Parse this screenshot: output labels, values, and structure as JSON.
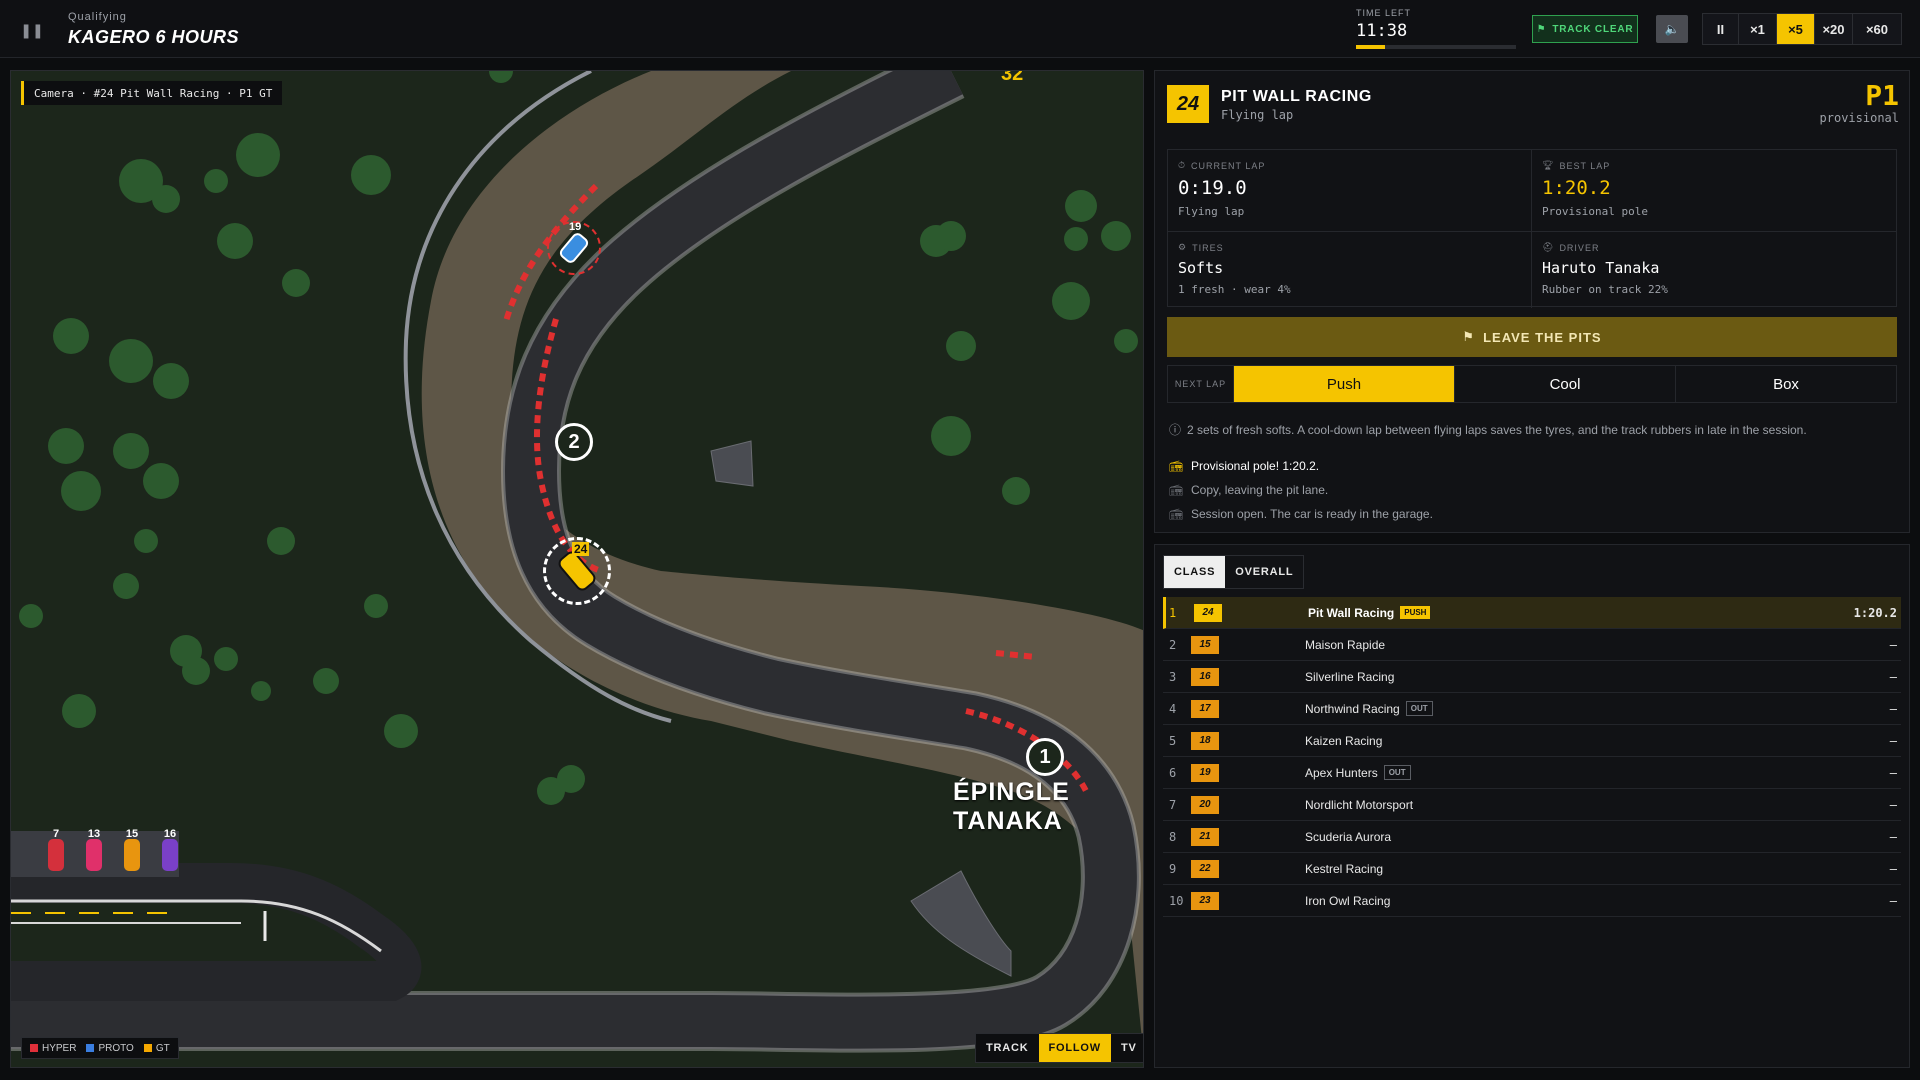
{
  "header": {
    "session_type": "Qualifying",
    "event_title": "KAGERO 6 HOURS",
    "time_left_label": "TIME LEFT",
    "time_left": "11:38",
    "time_left_fraction": 0.18,
    "flag_status": "TRACK CLEAR",
    "speed_options": [
      "II",
      "×1",
      "×5",
      "×20",
      "×60"
    ],
    "active_speed": "×5"
  },
  "map": {
    "camera_label": "Camera · #24 Pit Wall Racing · P1 GT",
    "corner_name": "ÉPINGLE TANAKA",
    "turn_numbers": [
      "1",
      "2"
    ],
    "partial_label": "32",
    "cars": [
      {
        "number": "24",
        "color": "#f5c400"
      },
      {
        "number": "19",
        "color": "#3a8ee0"
      }
    ],
    "garage_cars": [
      {
        "number": "7",
        "color": "#d4303c"
      },
      {
        "number": "13",
        "color": "#e0306a"
      },
      {
        "number": "15",
        "color": "#e8950f"
      },
      {
        "number": "16",
        "color": "#7a40c8"
      }
    ],
    "legend": [
      {
        "label": "HYPER",
        "color": "#e0303a"
      },
      {
        "label": "PROTO",
        "color": "#3a7ee0"
      },
      {
        "label": "GT",
        "color": "#f5a800"
      }
    ],
    "view_modes": [
      "TRACK",
      "FOLLOW",
      "TV"
    ],
    "active_view": "FOLLOW"
  },
  "car_panel": {
    "car_number": "24",
    "team": "PIT WALL RACING",
    "status": "Flying lap",
    "position": "P1",
    "position_note": "provisional",
    "current_lap_label": "CURRENT LAP",
    "current_lap": "0:19.0",
    "current_lap_note": "Flying lap",
    "best_lap_label": "BEST LAP",
    "best_lap": "1:20.2",
    "best_lap_note": "Provisional pole",
    "tires_label": "TIRES",
    "tires": "Softs",
    "tires_note": "1 fresh · wear 4%",
    "driver_label": "DRIVER",
    "driver": "Haruto Tanaka",
    "driver_note": "Rubber on track 22%",
    "action_button": "LEAVE THE PITS",
    "next_lap_label": "NEXT LAP",
    "next_lap_options": [
      "Push",
      "Cool",
      "Box"
    ],
    "next_lap_active": "Push",
    "tip": "2 sets of fresh softs. A cool-down lap between flying laps saves the tyres, and the track rubbers in late in the session.",
    "feed": [
      "Provisional pole! 1:20.2.",
      "Copy, leaving the pit lane.",
      "Session open. The car is ready in the garage."
    ]
  },
  "standings": {
    "tabs": [
      "CLASS",
      "OVERALL"
    ],
    "active_tab": "CLASS",
    "rows": [
      {
        "pos": "1",
        "num": "24",
        "team": "Pit Wall Racing",
        "badge": "PUSH",
        "time": "1:20.2"
      },
      {
        "pos": "2",
        "num": "15",
        "team": "Maison Rapide",
        "badge": "",
        "time": "–"
      },
      {
        "pos": "3",
        "num": "16",
        "team": "Silverline Racing",
        "badge": "",
        "time": "–"
      },
      {
        "pos": "4",
        "num": "17",
        "team": "Northwind Racing",
        "badge": "OUT",
        "time": "–"
      },
      {
        "pos": "5",
        "num": "18",
        "team": "Kaizen Racing",
        "badge": "",
        "time": "–"
      },
      {
        "pos": "6",
        "num": "19",
        "team": "Apex Hunters",
        "badge": "OUT",
        "time": "–"
      },
      {
        "pos": "7",
        "num": "20",
        "team": "Nordlicht Motorsport",
        "badge": "",
        "time": "–"
      },
      {
        "pos": "8",
        "num": "21",
        "team": "Scuderia Aurora",
        "badge": "",
        "time": "–"
      },
      {
        "pos": "9",
        "num": "22",
        "team": "Kestrel Racing",
        "badge": "",
        "time": "–"
      },
      {
        "pos": "10",
        "num": "23",
        "team": "Iron Owl Racing",
        "badge": "",
        "time": "–"
      }
    ]
  }
}
